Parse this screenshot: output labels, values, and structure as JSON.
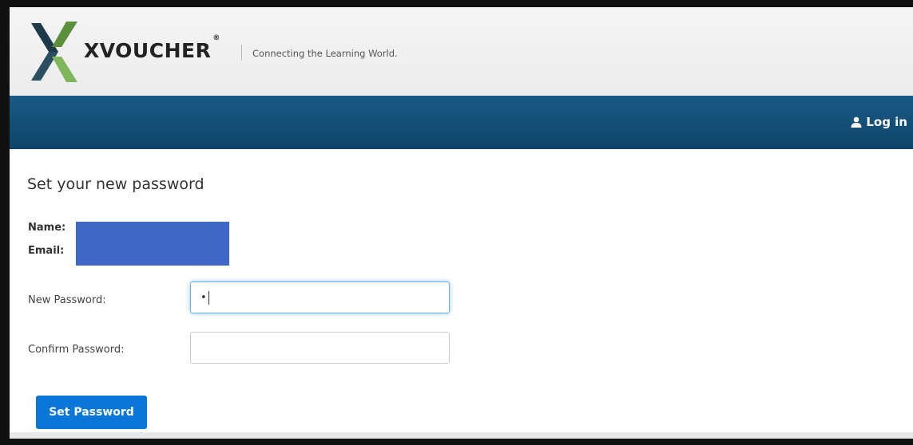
{
  "brand": {
    "name": "XVOUCHER",
    "registered": "®",
    "tagline": "Connecting the Learning World.",
    "colors": {
      "dark": "#1d3a4a",
      "green": "#5a8f3c",
      "light_green": "#7fb65a"
    }
  },
  "navbar": {
    "login_icon": "user-icon",
    "login_label": "Log in",
    "color": "#14507a"
  },
  "form": {
    "title": "Set your new password",
    "name_label": "Name:",
    "email_label": "Email:",
    "new_password_label": "New Password:",
    "new_password_value": "•",
    "confirm_password_label": "Confirm Password:",
    "confirm_password_value": "",
    "submit_label": "Set Password",
    "submit_color": "#0a76d8"
  }
}
